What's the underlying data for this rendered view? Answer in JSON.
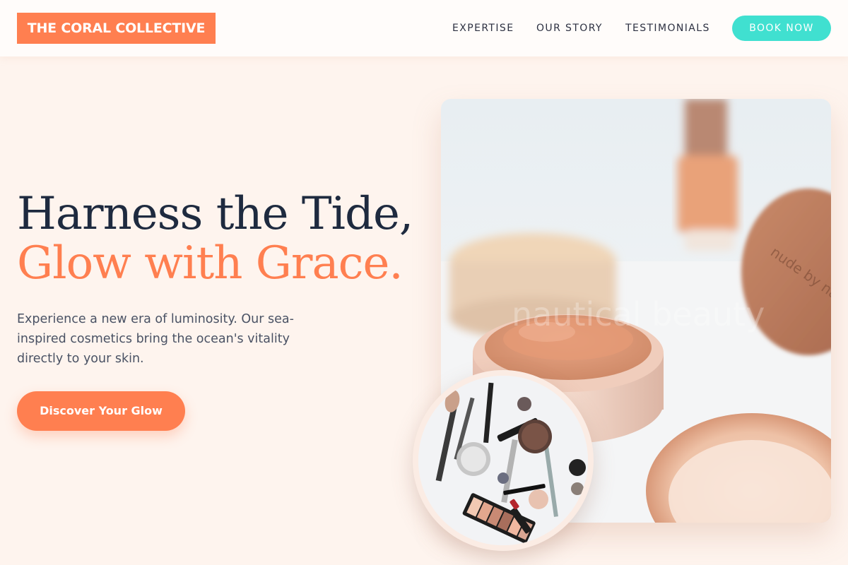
{
  "header": {
    "logo": "THE CORAL COLLECTIVE",
    "nav": [
      {
        "label": "EXPERTISE"
      },
      {
        "label": "OUR STORY"
      },
      {
        "label": "TESTIMONIALS"
      }
    ],
    "book_label": "BOOK NOW"
  },
  "hero": {
    "title_line1": "Harness the Tide,",
    "title_line2": "Glow with Grace.",
    "description": "Experience a new era of luminosity. Our sea-inspired cosmetics bring the ocean's vitality directly to your skin.",
    "cta_label": "Discover Your Glow",
    "image_watermark": "nautical beauty",
    "jar_lid_text": "nude by na"
  },
  "colors": {
    "accent": "#ff7f50",
    "teal": "#40e0d0",
    "background": "#fef4ee",
    "heading": "#1e2a3f",
    "body_text": "#4a5264"
  },
  "icons": {
    "hero_photo": "cosmetics-powder-jars-photo",
    "inset_photo": "makeup-flatlay-photo"
  }
}
